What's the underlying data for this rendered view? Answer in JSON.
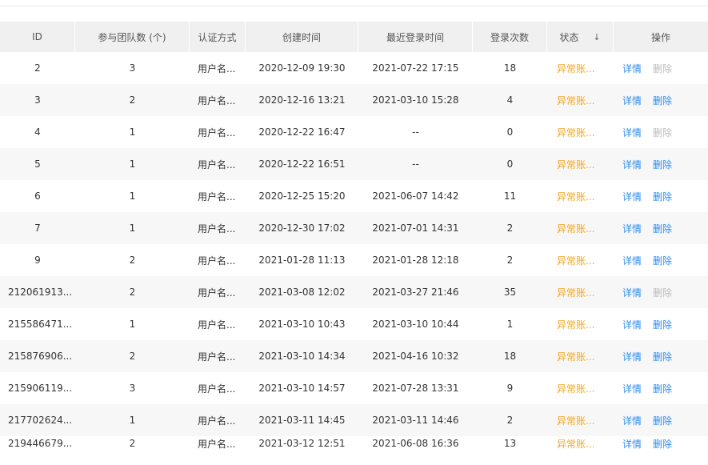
{
  "columns": {
    "id": "ID",
    "teams": "参与团队数 (个)",
    "auth": "认证方式",
    "created": "创建时间",
    "last_login": "最近登录时间",
    "login_count": "登录次数",
    "status": "状态",
    "sort_icon": "↓",
    "actions": "操作"
  },
  "rows": [
    {
      "id": "2",
      "teams": "3",
      "auth": "用户名...",
      "created": "2020-12-09 19:30",
      "last": "2021-07-22 17:15",
      "count": "18",
      "status": "异常账...",
      "detail": "详情",
      "del": "删除"
    },
    {
      "id": "3",
      "teams": "2",
      "auth": "用户名...",
      "created": "2020-12-16 13:21",
      "last": "2021-03-10 15:28",
      "count": "4",
      "status": "异常账...",
      "detail": "详情",
      "del": "删除"
    },
    {
      "id": "4",
      "teams": "1",
      "auth": "用户名...",
      "created": "2020-12-22 16:47",
      "last": "--",
      "count": "0",
      "status": "异常账...",
      "detail": "详情",
      "del": "删除"
    },
    {
      "id": "5",
      "teams": "1",
      "auth": "用户名...",
      "created": "2020-12-22 16:51",
      "last": "--",
      "count": "0",
      "status": "异常账...",
      "detail": "详情",
      "del": "删除"
    },
    {
      "id": "6",
      "teams": "1",
      "auth": "用户名...",
      "created": "2020-12-25 15:20",
      "last": "2021-06-07 14:42",
      "count": "11",
      "status": "异常账...",
      "detail": "详情",
      "del": "删除"
    },
    {
      "id": "7",
      "teams": "1",
      "auth": "用户名...",
      "created": "2020-12-30 17:02",
      "last": "2021-07-01 14:31",
      "count": "2",
      "status": "异常账...",
      "detail": "详情",
      "del": "删除"
    },
    {
      "id": "9",
      "teams": "2",
      "auth": "用户名...",
      "created": "2021-01-28 11:13",
      "last": "2021-01-28 12:18",
      "count": "2",
      "status": "异常账...",
      "detail": "详情",
      "del": "删除"
    },
    {
      "id": "212061913...",
      "teams": "2",
      "auth": "用户名...",
      "created": "2021-03-08 12:02",
      "last": "2021-03-27 21:46",
      "count": "35",
      "status": "异常账...",
      "detail": "详情",
      "del": "删除"
    },
    {
      "id": "215586471...",
      "teams": "1",
      "auth": "用户名...",
      "created": "2021-03-10 10:43",
      "last": "2021-03-10 10:44",
      "count": "1",
      "status": "异常账...",
      "detail": "详情",
      "del": "删除"
    },
    {
      "id": "215876906...",
      "teams": "2",
      "auth": "用户名...",
      "created": "2021-03-10 14:34",
      "last": "2021-04-16 10:32",
      "count": "18",
      "status": "异常账...",
      "detail": "详情",
      "del": "删除"
    },
    {
      "id": "215906119...",
      "teams": "3",
      "auth": "用户名...",
      "created": "2021-03-10 14:57",
      "last": "2021-07-28 13:31",
      "count": "9",
      "status": "异常账...",
      "detail": "详情",
      "del": "删除"
    },
    {
      "id": "217702624...",
      "teams": "1",
      "auth": "用户名...",
      "created": "2021-03-11 14:45",
      "last": "2021-03-11 14:46",
      "count": "2",
      "status": "异常账...",
      "detail": "详情",
      "del": "删除"
    },
    {
      "id": "219446679...",
      "teams": "2",
      "auth": "用户名...",
      "created": "2021-03-12 12:51",
      "last": "2021-06-08 16:36",
      "count": "13",
      "status": "异常账...",
      "detail": "详情",
      "del": "删除"
    }
  ],
  "delete_disabled_rows": [
    0,
    2,
    7
  ],
  "colors": {
    "status": "#f5a623",
    "link": "#2d8cf0",
    "disabled": "#bbbbbb",
    "header_bg": "#f0f0f0",
    "stripe_bg": "#f7f7f7"
  }
}
